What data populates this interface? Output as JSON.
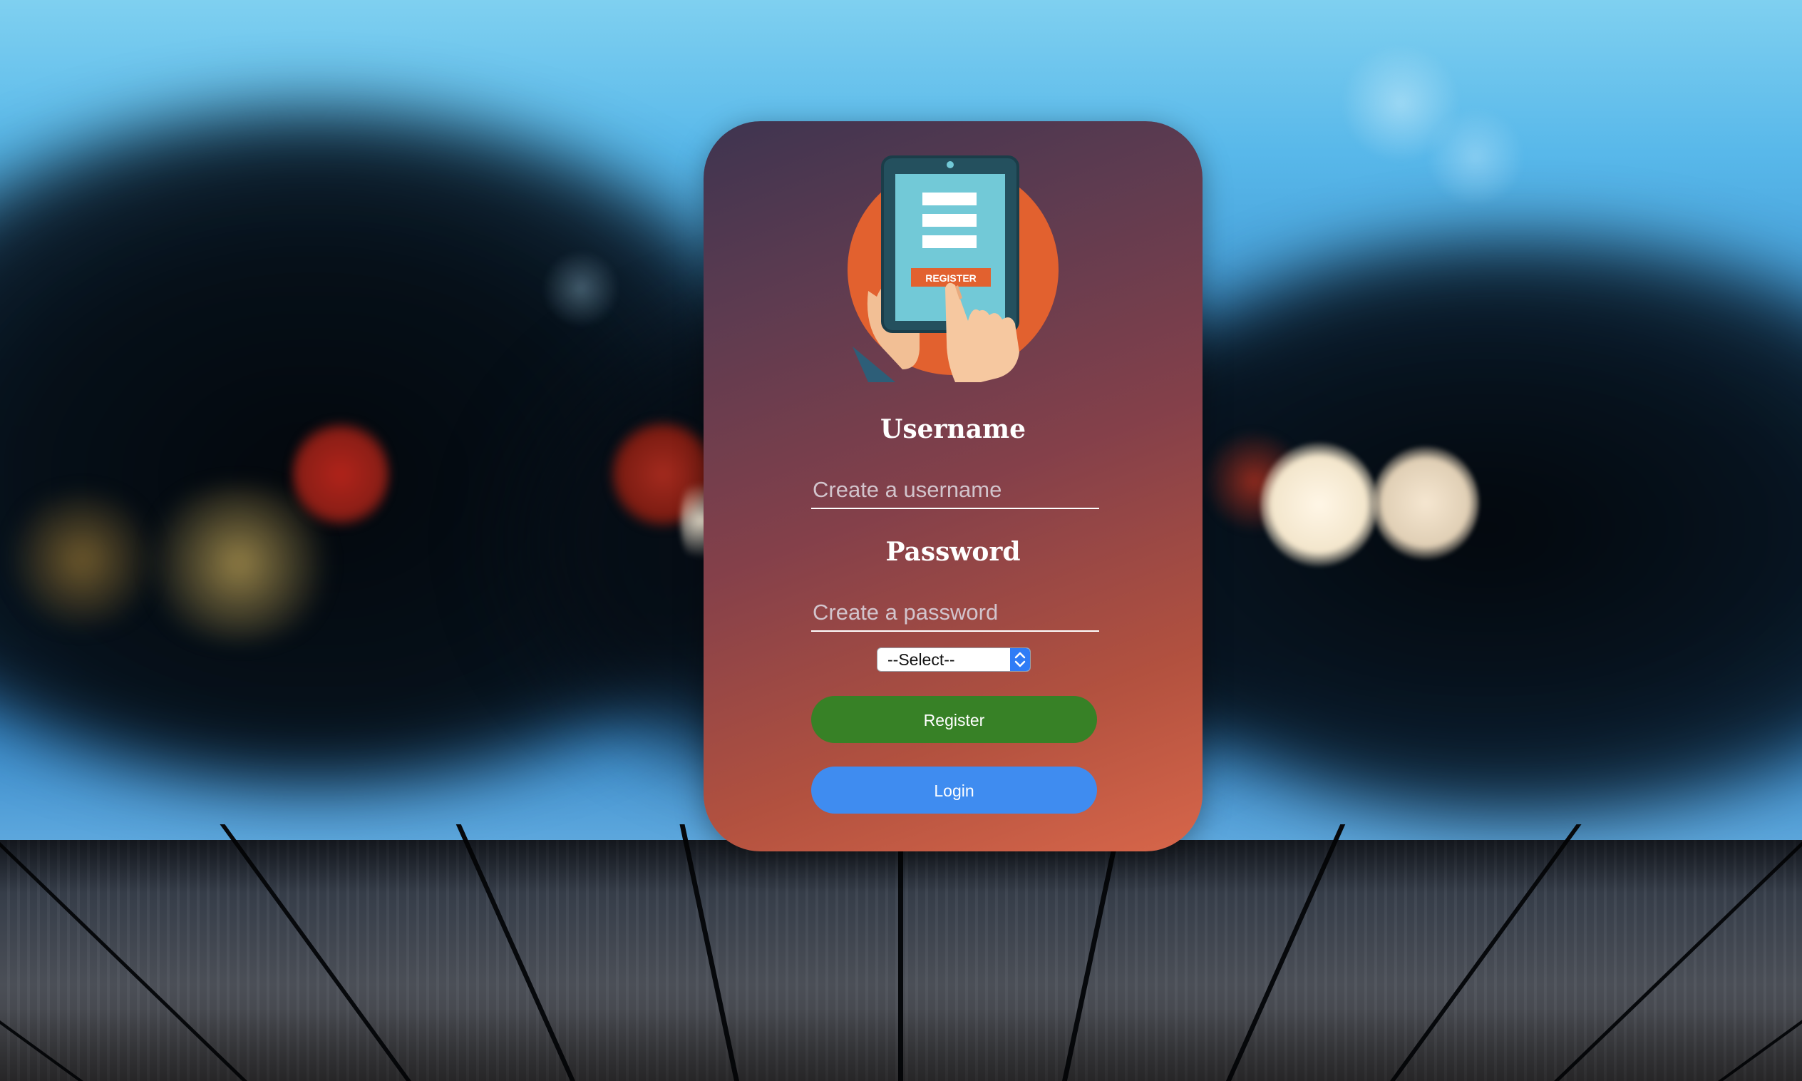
{
  "form": {
    "username_heading": "Username",
    "username_placeholder": "Create a username",
    "password_heading": "Password",
    "password_placeholder": "Create a password",
    "select_value": "--Select--",
    "register_button": "Register",
    "login_button": "Login"
  },
  "illustration": {
    "icon": "tablet-register-illustration",
    "caption": "REGISTER"
  },
  "colors": {
    "card_gradient_start": "#3e3450",
    "card_gradient_end": "#d7664a",
    "register_button": "#378126",
    "login_button": "#3f8cf0",
    "illustration_circle": "#e2612f",
    "tablet_screen": "#72c9d7"
  }
}
